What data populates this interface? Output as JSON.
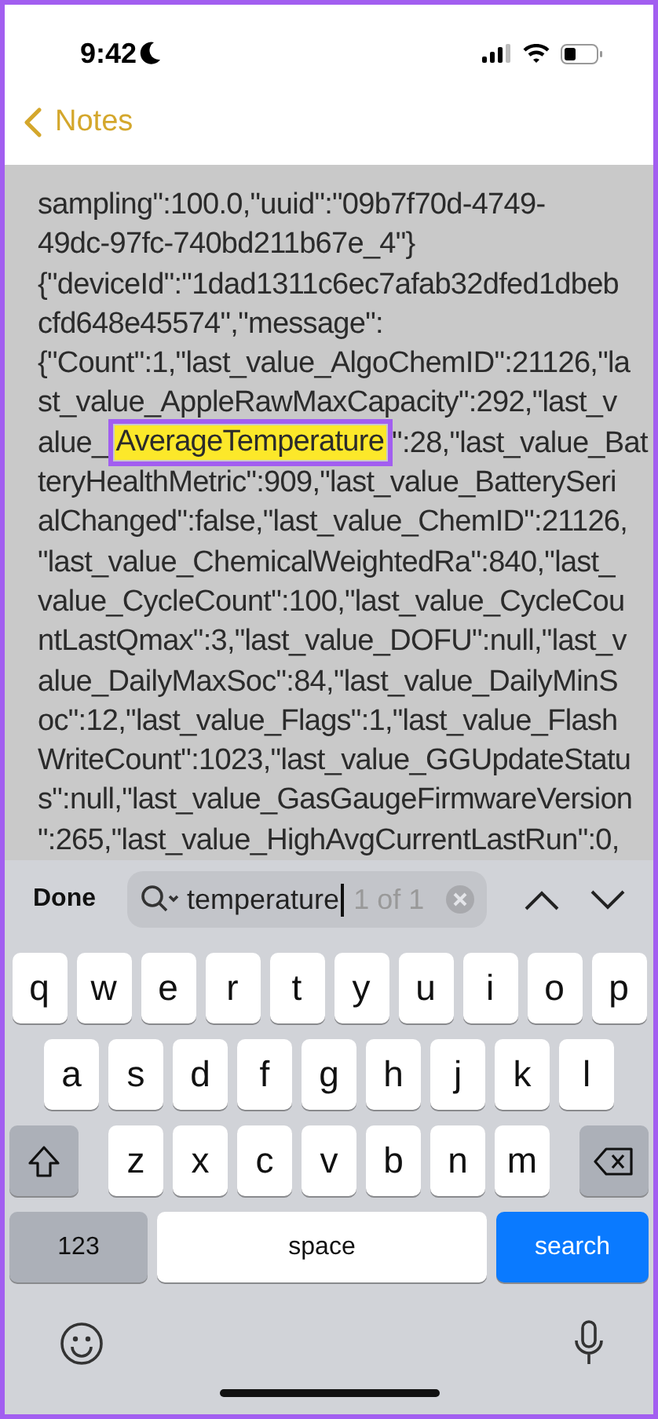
{
  "status_bar": {
    "time": "9:42"
  },
  "nav": {
    "back_label": "Notes"
  },
  "note_lines": [
    {
      "text": "sampling\":100.0,\"uuid\":\"09b7f70d-4749-"
    },
    {
      "text": "49dc-97fc-740bd211b67e_4\"}"
    },
    {
      "text": "{\"deviceId\":\"1dad1311c6ec7afab32dfed1dbeb"
    },
    {
      "text": "cfd648e45574\",\"message\":"
    },
    {
      "text": "{\"Count\":1,\"last_value_AlgoChemID\":21126,\"la"
    },
    {
      "text": "st_value_AppleRawMaxCapacity\":292,\"last_v"
    },
    {
      "before": "alue_",
      "match": "AverageTemperature",
      "after": "\":28,\"last_value_Bat"
    },
    {
      "text": "teryHealthMetric\":909,\"last_value_BatterySeri"
    },
    {
      "text": "alChanged\":false,\"last_value_ChemID\":21126,"
    },
    {
      "text": "\"last_value_ChemicalWeightedRa\":840,\"last_"
    },
    {
      "text": "value_CycleCount\":100,\"last_value_CycleCou"
    },
    {
      "text": "ntLastQmax\":3,\"last_value_DOFU\":null,\"last_v"
    },
    {
      "text": "alue_DailyMaxSoc\":84,\"last_value_DailyMinS"
    },
    {
      "text": "oc\":12,\"last_value_Flags\":1,\"last_value_Flash"
    },
    {
      "text": "WriteCount\":1023,\"last_value_GGUpdateStatu"
    },
    {
      "text": "s\":null,\"last_value_GasGaugeFirmwareVersion"
    },
    {
      "text": "\":265,\"last_value_HighAvgCurrentLastRun\":0,"
    }
  ],
  "find_bar": {
    "done_label": "Done",
    "query": "temperature",
    "match_count": "1 of 1"
  },
  "keyboard": {
    "letter_rows": [
      [
        "q",
        "w",
        "e",
        "r",
        "t",
        "y",
        "u",
        "i",
        "o",
        "p"
      ],
      [
        "a",
        "s",
        "d",
        "f",
        "g",
        "h",
        "j",
        "k",
        "l"
      ],
      [
        "z",
        "x",
        "c",
        "v",
        "b",
        "n",
        "m"
      ]
    ],
    "bottom_row": {
      "numbers_key": "123",
      "space_key": "space",
      "search_key": "search"
    }
  }
}
